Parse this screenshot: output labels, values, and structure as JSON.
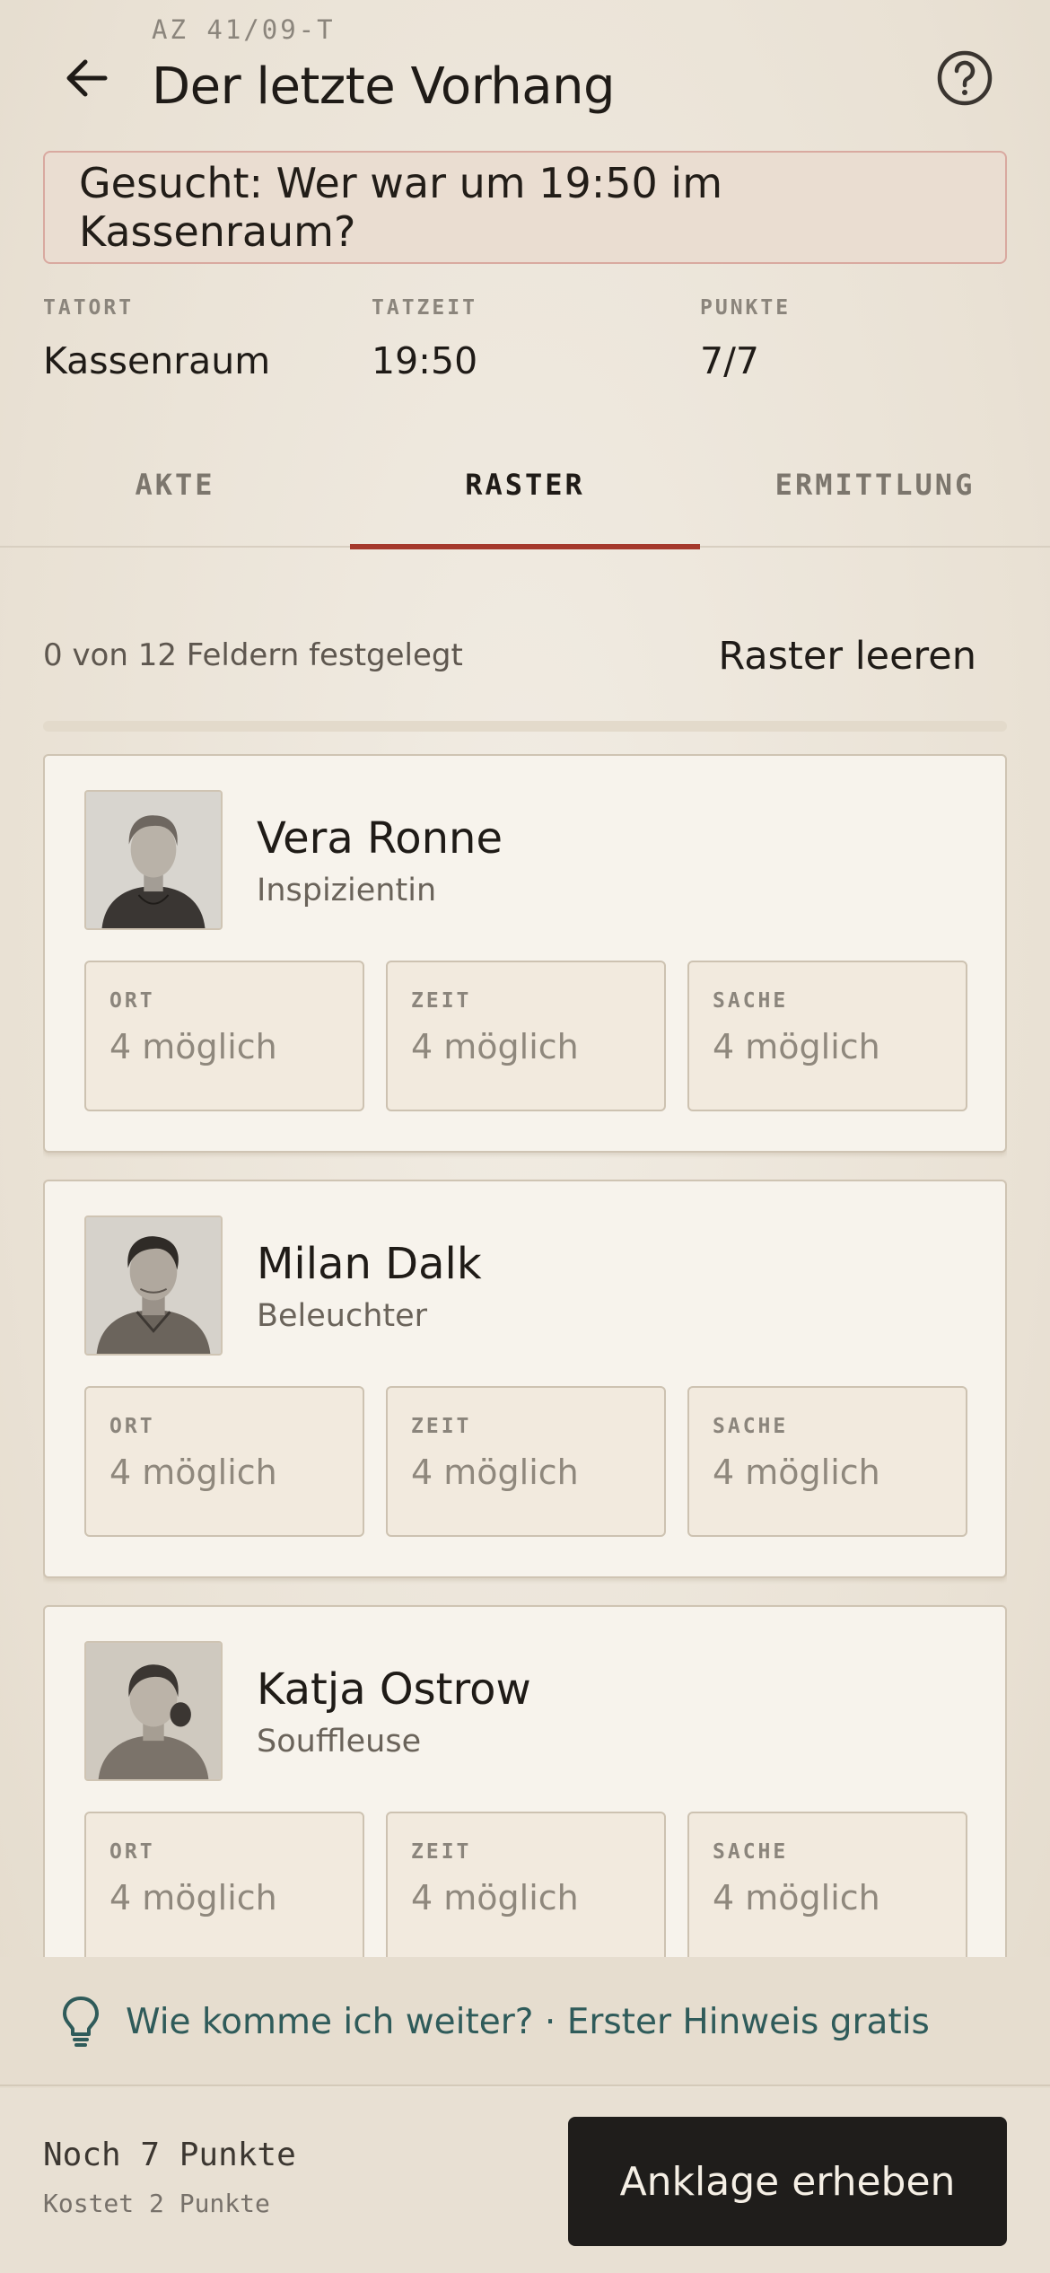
{
  "header": {
    "case_number": "AZ 41/09-T",
    "title": "Der letzte Vorhang",
    "back_icon": "arrow-left-icon",
    "help_icon": "question-circle-icon"
  },
  "banner": {
    "text": "Gesucht: Wer war um 19:50 im Kassenraum?"
  },
  "stats": [
    {
      "label": "TATORT",
      "value": "Kassenraum"
    },
    {
      "label": "TATZEIT",
      "value": "19:50"
    },
    {
      "label": "PUNKTE",
      "value": "7/7"
    }
  ],
  "tabs": [
    {
      "label": "AKTE",
      "active": false
    },
    {
      "label": "RASTER",
      "active": true
    },
    {
      "label": "ERMITTLUNG",
      "active": false
    }
  ],
  "grid": {
    "progress_text": "0 von 12 Feldern festgelegt",
    "progress_fraction": 0,
    "clear_label": "Raster leeren"
  },
  "suspects": [
    {
      "name": "Vera Ronne",
      "role": "Inspizientin",
      "fields": [
        {
          "label": "ORT",
          "value": "4 möglich"
        },
        {
          "label": "ZEIT",
          "value": "4 möglich"
        },
        {
          "label": "SACHE",
          "value": "4 möglich"
        }
      ]
    },
    {
      "name": "Milan Dalk",
      "role": "Beleuchter",
      "fields": [
        {
          "label": "ORT",
          "value": "4 möglich"
        },
        {
          "label": "ZEIT",
          "value": "4 möglich"
        },
        {
          "label": "SACHE",
          "value": "4 möglich"
        }
      ]
    },
    {
      "name": "Katja Ostrow",
      "role": "Souffleuse",
      "fields": [
        {
          "label": "ORT",
          "value": "4 möglich"
        },
        {
          "label": "ZEIT",
          "value": "4 möglich"
        },
        {
          "label": "SACHE",
          "value": "4 möglich"
        }
      ]
    }
  ],
  "hint": {
    "icon": "lightbulb-icon",
    "text": "Wie komme ich weiter? · Erster Hinweis gratis"
  },
  "footer": {
    "points_remaining": "Noch 7 Punkte",
    "cost": "Kostet 2 Punkte",
    "accuse_label": "Anklage erheben"
  },
  "colors": {
    "accent": "#a5392c",
    "hint": "#2f5b5a",
    "button_dark": "#1f1d1b",
    "background": "#ece5d9"
  }
}
